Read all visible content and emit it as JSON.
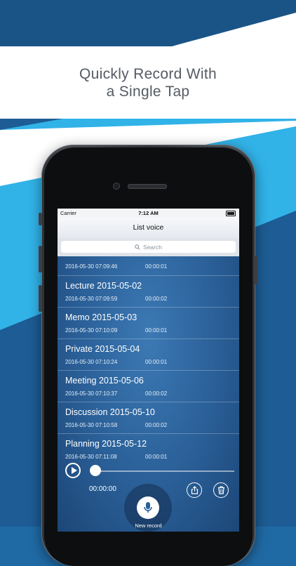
{
  "banner": {
    "line1": "Quickly Record With",
    "line2": "a Single Tap"
  },
  "colors": {
    "navy": "#1d5c94",
    "lightBlue": "#31b3e8",
    "white": "#ffffff"
  },
  "status": {
    "carrier": "Carrier",
    "time": "7:12 AM"
  },
  "nav": {
    "title": "List voice"
  },
  "search": {
    "placeholder": "Search"
  },
  "recordings": [
    {
      "name": "",
      "date": "2016-05-30 07:09:46",
      "duration": "00:00:01"
    },
    {
      "name": "Lecture 2015-05-02",
      "date": "2016-05-30 07:09:59",
      "duration": "00:00:02"
    },
    {
      "name": "Memo 2015-05-03",
      "date": "2016-05-30 07:10:09",
      "duration": "00:00:01"
    },
    {
      "name": "Private 2015-05-04",
      "date": "2016-05-30 07:10:24",
      "duration": "00:00:01"
    },
    {
      "name": "Meeting 2015-05-06",
      "date": "2016-05-30 07:10:37",
      "duration": "00:00:02"
    },
    {
      "name": "Discussion 2015-05-10",
      "date": "2016-05-30 07:10:58",
      "duration": "00:00:02"
    },
    {
      "name": "Planning 2015-05-12",
      "date": "2016-05-30 07:11:08",
      "duration": "00:00:01"
    }
  ],
  "player": {
    "elapsed": "00:00:00",
    "progress": 0
  },
  "record": {
    "label": "New record"
  },
  "icons": {
    "play": "play-icon",
    "share": "share-icon",
    "trash": "trash-icon",
    "mic": "microphone-icon",
    "search": "search-icon"
  }
}
